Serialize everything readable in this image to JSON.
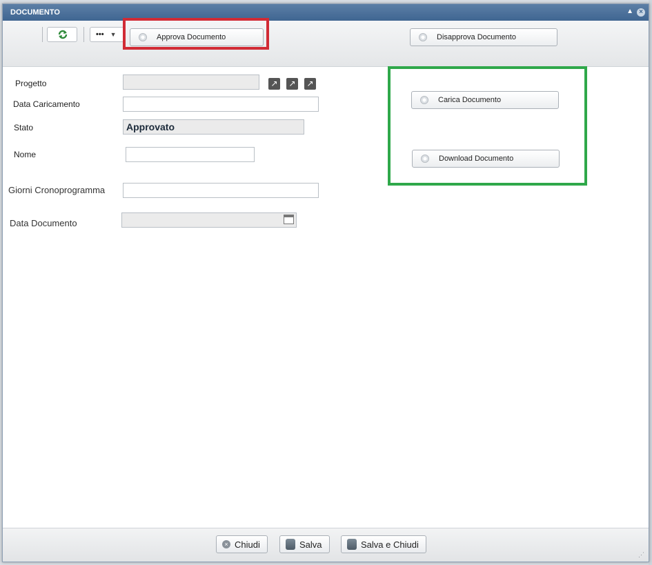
{
  "window": {
    "title": "DOCUMENTO"
  },
  "toolbar": {
    "more_label": "•••",
    "approve_label": "Approva Documento",
    "disapprove_label": "Disapprova Documento"
  },
  "form": {
    "progetto_label": "Progetto",
    "data_caricamento_label": "Data Caricamento",
    "stato_label": "Stato",
    "stato_value": "Approvato",
    "nome_label": "Nome",
    "giorni_label": "Giorni Cronoprogramma",
    "data_documento_label": "Data Documento"
  },
  "side_actions": {
    "carica_label": "Carica Documento",
    "download_label": "Download Documento"
  },
  "footer": {
    "chiudi_label": "Chiudi",
    "salva_label": "Salva",
    "salva_chiudi_label": "Salva e Chiudi"
  },
  "colors": {
    "highlight_red": "#d12b35",
    "highlight_green": "#2fa84a",
    "titlebar": "#3f6591"
  }
}
